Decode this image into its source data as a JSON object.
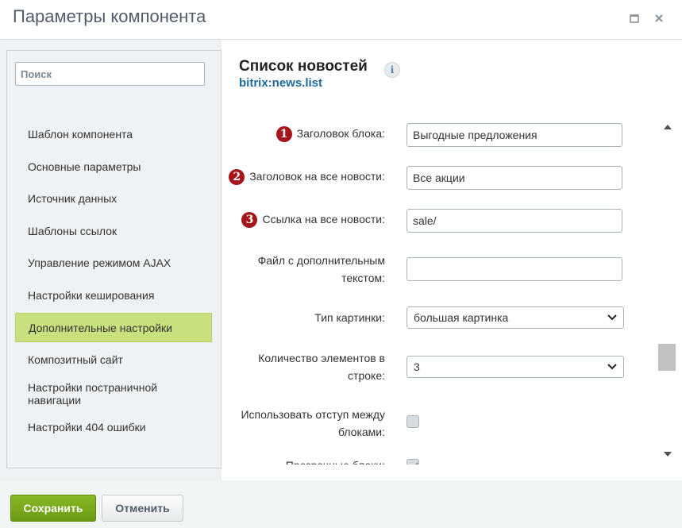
{
  "dialog": {
    "title": "Параметры компонента",
    "maximize_icon": "maximize-icon",
    "close_icon": "close-icon"
  },
  "sidebar": {
    "search_placeholder": "Поиск",
    "items": [
      {
        "label": "Шаблон компонента",
        "active": false
      },
      {
        "label": "Основные параметры",
        "active": false
      },
      {
        "label": "Источник данных",
        "active": false
      },
      {
        "label": "Шаблоны ссылок",
        "active": false
      },
      {
        "label": "Управление режимом AJAX",
        "active": false
      },
      {
        "label": "Настройки кеширования",
        "active": false
      },
      {
        "label": "Дополнительные настройки",
        "active": true
      },
      {
        "label": "Композитный сайт",
        "active": false
      },
      {
        "label": "Настройки постраничной навигации",
        "active": false
      },
      {
        "label": "Настройки 404 ошибки",
        "active": false
      }
    ]
  },
  "component": {
    "title": "Список новостей",
    "code": "bitrix:news.list",
    "info_icon": "i"
  },
  "form": {
    "block_title": {
      "badge": "1",
      "label": "Заголовок блока:",
      "value": "Выгодные предложения"
    },
    "all_news_title": {
      "badge": "2",
      "label": "Заголовок на все новости:",
      "value": "Все акции"
    },
    "all_news_link": {
      "badge": "3",
      "label": "Ссылка на все новости:",
      "value": "sale/"
    },
    "extra_text_file": {
      "label": "Файл с дополнительным текстом:",
      "value": ""
    },
    "image_type": {
      "label": "Тип картинки:",
      "value": "большая картинка"
    },
    "items_per_row": {
      "label": "Количество элементов в строке:",
      "value": "3"
    },
    "use_block_gap": {
      "label": "Использовать отступ между блоками:",
      "checked": false
    },
    "transparent_blocks": {
      "label": "Прозрачные блоки:",
      "checked": true
    }
  },
  "footer": {
    "save_label": "Сохранить",
    "cancel_label": "Отменить"
  },
  "colors": {
    "accent_green": "#6c9a14",
    "active_nav": "#c9e07e",
    "badge_red": "#a5151b",
    "link_blue": "#1f6a9c"
  }
}
